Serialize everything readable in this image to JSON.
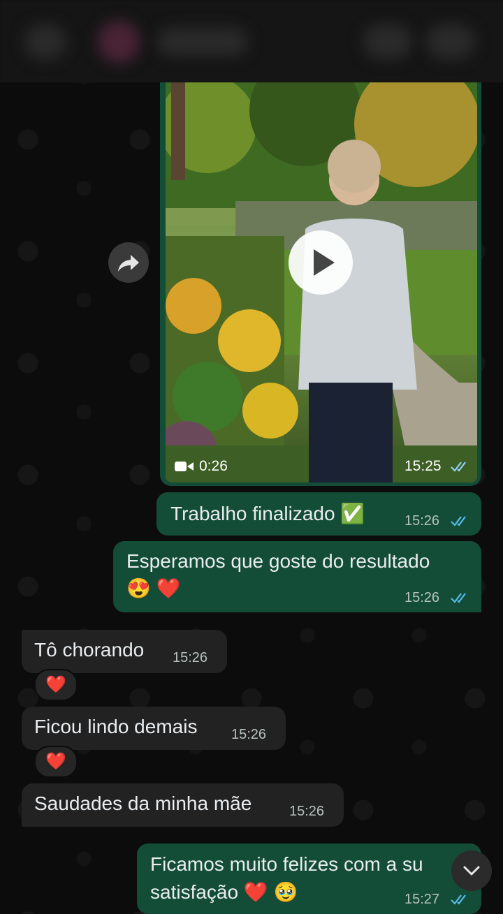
{
  "video": {
    "duration": "0:26",
    "time": "15:25"
  },
  "messages": [
    {
      "side": "out",
      "text": "Trabalho finalizado ✅",
      "time": "15:26"
    },
    {
      "side": "out",
      "line1": "Esperamos que goste do resultado",
      "line2": "😍 ❤️",
      "time": "15:26"
    },
    {
      "side": "in",
      "text": "Tô chorando",
      "time": "15:26",
      "reaction": "❤️"
    },
    {
      "side": "in",
      "text": "Ficou lindo demais",
      "time": "15:26",
      "reaction": "❤️"
    },
    {
      "side": "in",
      "text": "Saudades da minha mãe",
      "time": "15:26"
    },
    {
      "side": "out",
      "line1": "Ficamos muito felizes com a su",
      "line2": "satisfação ❤️ 🥹",
      "time": "15:27"
    }
  ],
  "colors": {
    "outgoing": "#144d37",
    "incoming": "#222223",
    "read_ticks": "#53bdeb"
  },
  "icons": {
    "forward": "forward-icon",
    "play": "play-icon",
    "camera": "video-camera-icon",
    "scroll": "chevron-down-icon"
  }
}
